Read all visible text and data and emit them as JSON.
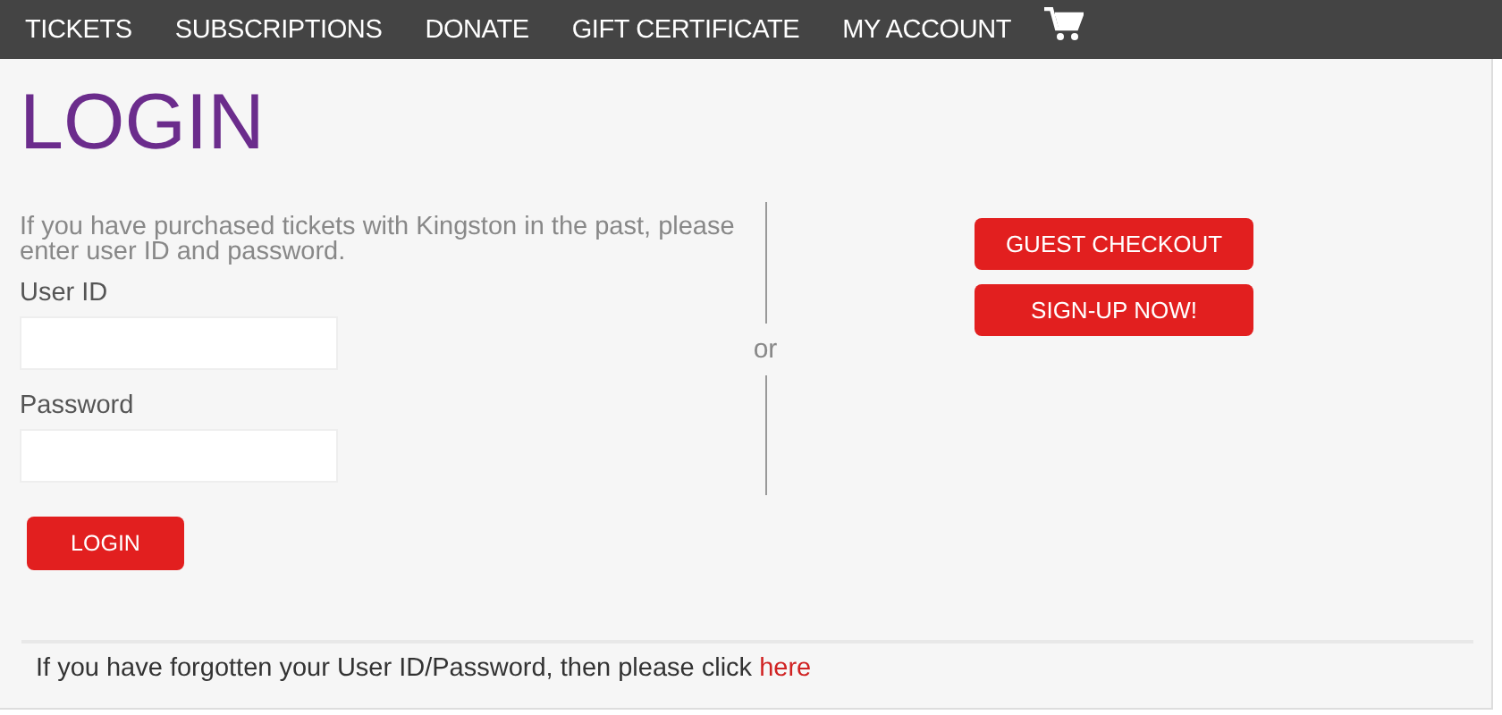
{
  "nav": {
    "items": [
      "TICKETS",
      "SUBSCRIPTIONS",
      "DONATE",
      "GIFT CERTIFICATE",
      "MY ACCOUNT"
    ]
  },
  "title": "LOGIN",
  "intro": "If you have purchased tickets with Kingston in the past, please enter user ID and password.",
  "fields": [
    {
      "label": "User ID"
    },
    {
      "label": "Password"
    }
  ],
  "login_button": "LOGIN",
  "separator": "or",
  "buttons": [
    "GUEST CHECKOUT",
    "SIGN-UP NOW!"
  ],
  "footer": {
    "text": "If you have forgotten your User ID/Password, then please click",
    "link": "here"
  }
}
